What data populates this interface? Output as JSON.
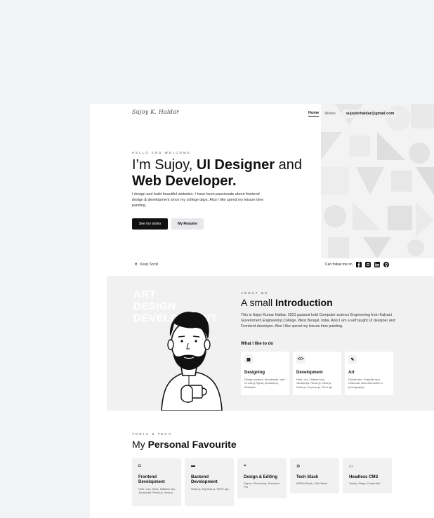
{
  "header": {
    "logo": "Sujoy K. Haldar",
    "nav": {
      "home": "Home",
      "works": "Works",
      "email": "sujoykrhaldar@gmail.com"
    }
  },
  "hero": {
    "eyebrow": "HELLO AND WELCOME",
    "line1_pre": "I’m Sujoy, ",
    "line1_bold": "UI Designer",
    "line1_post": " and",
    "line2_bold": "Web Developer.",
    "description": "I design and build beautiful websites. I have been passionate about frontend design & development since my college days. Also I like spend my leisure time painting.",
    "primary_button": "See my works",
    "secondary_button": "My Resume",
    "scroll": "Keep Scroll",
    "follow": "Can follow me on",
    "socials": [
      "facebook-icon",
      "instagram-icon",
      "linkedin-icon",
      "github-icon"
    ]
  },
  "about": {
    "bg_words": [
      "ART",
      "DESIGN",
      "DEVELOPMENT"
    ],
    "eyebrow": "ABOUT ME",
    "title_pre": "A small ",
    "title_bold": "Introduction",
    "description": "This is Sujoy Kumar Haldar, 2021 passout hold Computer science Engineering from Kalyani Government Engineering College, West Bengal, India. Also I am a self taught UI designer and Frontend developer. Also I like spend my leisure time painting.",
    "like_title": "What I like to do",
    "cards": [
      {
        "icon": "grid-icon",
        "glyph": "▦",
        "title": "Designing",
        "desc": "Design posters, thumbnails, web UI using Figma, photoshop, illustrator"
      },
      {
        "icon": "code-icon",
        "glyph": "</>",
        "title": "Development",
        "desc": "Html, css, Tailwind css, Javascript, React.js, Next.js, Node.js, Express.js, Rest api"
      },
      {
        "icon": "magic-wand-icon",
        "glyph": "✎",
        "title": "Art",
        "desc": "Potrait arts. Graphite and Charcoal. Also interested in photography."
      }
    ]
  },
  "tools": {
    "eyebrow": "TOOLS & TECH",
    "title_pre": "My ",
    "title_bold": "Personal Favourite",
    "items": [
      {
        "icon": "layers-icon",
        "glyph": "◘",
        "title": "Frontend Development",
        "desc": "Html, Css, Scss, Tailwind css, Javascript, React.js, Next.js"
      },
      {
        "icon": "file-icon",
        "glyph": "▬",
        "title": "Backend Development",
        "desc": "Node.js, Express.js, REST api"
      },
      {
        "icon": "crop-icon",
        "glyph": "⌗",
        "title": "Design & Editing",
        "desc": "Figma, Photoshop, Premiere Pro"
      },
      {
        "icon": "gear-icon",
        "glyph": "⚙",
        "title": "Tech Stack",
        "desc": "MERN Stack, JAM Stack"
      },
      {
        "icon": "monitor-icon",
        "glyph": "▭",
        "title": "Headless CMS",
        "desc": "Sanity, Strapi, Contentful"
      }
    ]
  }
}
